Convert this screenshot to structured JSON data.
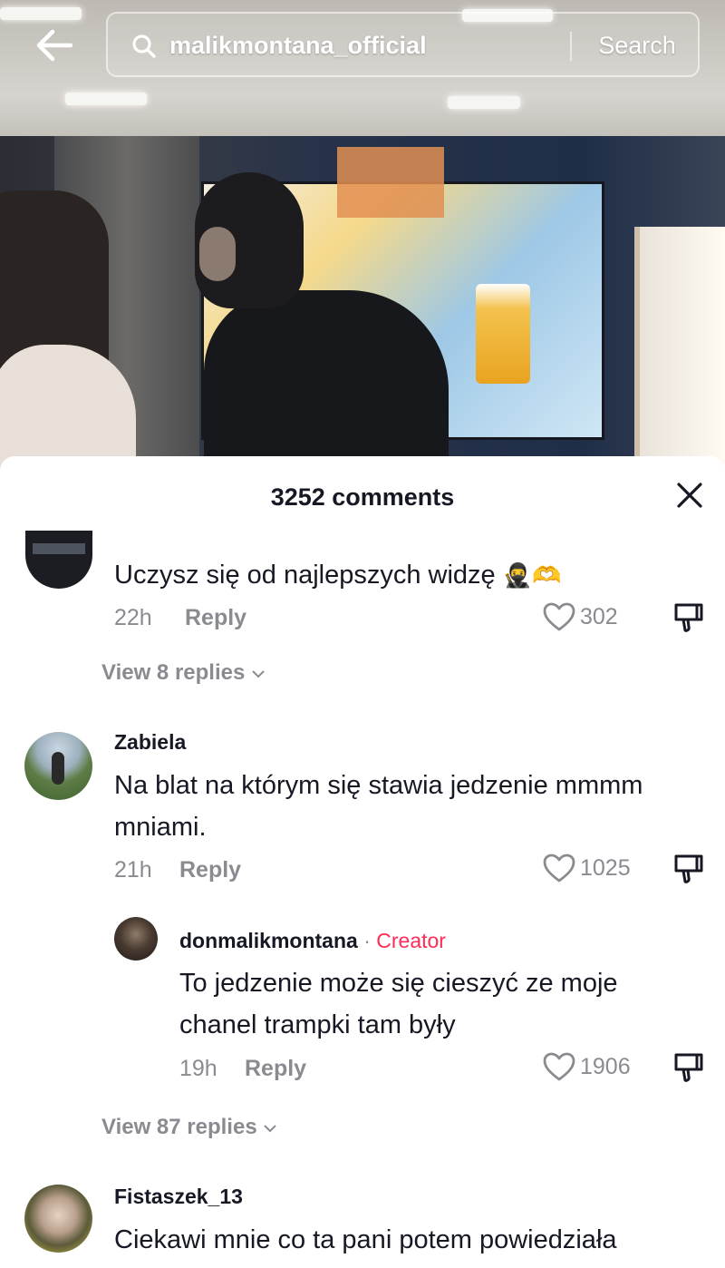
{
  "search": {
    "query": "malikmontana_official",
    "button_label": "Search"
  },
  "comments_panel": {
    "title": "3252 comments"
  },
  "comments": [
    {
      "username": "",
      "text": "Uczysz się od najlepszych widzę",
      "emoji": "🥷🫶",
      "time": "22h",
      "reply_label": "Reply",
      "likes": "302",
      "view_replies": "View 8 replies"
    },
    {
      "username": "Zabiela",
      "text_line1": "Na blat na którym się stawia jedzenie mmmm",
      "text_line2": "mniami.",
      "time": "21h",
      "reply_label": "Reply",
      "likes": "1025",
      "reply": {
        "username": "donmalikmontana",
        "separator": "·",
        "badge": "Creator",
        "text_line1": "To jedzenie może się cieszyć ze moje",
        "text_line2": "chanel trampki tam były",
        "time": "19h",
        "reply_label": "Reply",
        "likes": "1906"
      },
      "view_replies": "View 87 replies"
    },
    {
      "username": "Fistaszek_13",
      "text": "Ciekawi mnie co ta pani potem powiedziała"
    }
  ],
  "colors": {
    "creator_accent": "#fe2c55",
    "muted_text": "#8a8b91",
    "primary_text": "#161823"
  },
  "icons": [
    "back-arrow-icon",
    "search-icon",
    "close-icon",
    "heart-icon",
    "dislike-icon",
    "chevron-down-icon"
  ]
}
